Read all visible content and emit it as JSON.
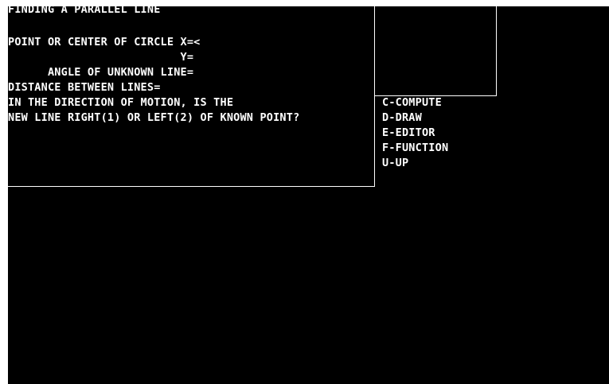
{
  "prompt_window": {
    "title": "FINDING A PARALLEL LINE",
    "lines": [
      "POINT OR CENTER OF CIRCLE X=<",
      "                          Y=",
      "      ANGLE OF UNKNOWN LINE=",
      "DISTANCE BETWEEN LINES=",
      "IN THE DIRECTION OF MOTION, IS THE",
      "NEW LINE RIGHT(1) OR LEFT(2) OF KNOWN POINT?"
    ]
  },
  "menu": {
    "items": [
      {
        "label": "C-COMPUTE"
      },
      {
        "label": "D-DRAW"
      },
      {
        "label": "E-EDITOR"
      },
      {
        "label": "F-FUNCTION"
      },
      {
        "label": "U-UP"
      }
    ]
  },
  "colors": {
    "background": "#000000",
    "foreground": "#ffffff",
    "frame": "#ffffff"
  }
}
